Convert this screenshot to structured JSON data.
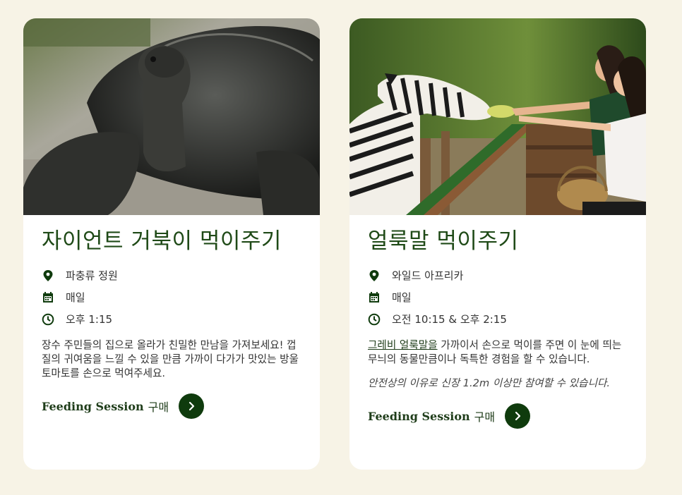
{
  "cards": [
    {
      "title": "자이언트 거북이 먹이주기",
      "image_icon": "giant-tortoise-photo",
      "location": "파충류 정원",
      "days": "매일",
      "time": "오후 1:15",
      "description": "장수 주민들의 집으로 올라가 친밀한 만남을 가져보세요! 껍질의 귀여움을 느낄 수 있을 만큼 가까이 다가가 맛있는 방울토마토를 손으로 먹여주세요.",
      "cta_label": "Feeding Session",
      "cta_suffix": "구매"
    },
    {
      "title": "얼룩말 먹이주기",
      "image_icon": "zebra-feeding-photo",
      "location": "와일드 아프리카",
      "days": "매일",
      "time": "오전 10:15 & 오후 2:15",
      "description_link": "그레비 얼룩말을",
      "description_rest": " 가까이서 손으로 먹이를 주면 이 눈에 띄는 무늬의 동물만큼이나 독특한 경험을 할 수 있습니다.",
      "note": "안전상의 이유로 신장 1.2m 이상만 참여할 수 있습니다.",
      "cta_label": "Feeding Session",
      "cta_suffix": "구매"
    }
  ],
  "colors": {
    "background": "#f7f3e6",
    "title_green": "#1f4a17",
    "button_green": "#0f3b0d",
    "card": "#ffffff"
  }
}
